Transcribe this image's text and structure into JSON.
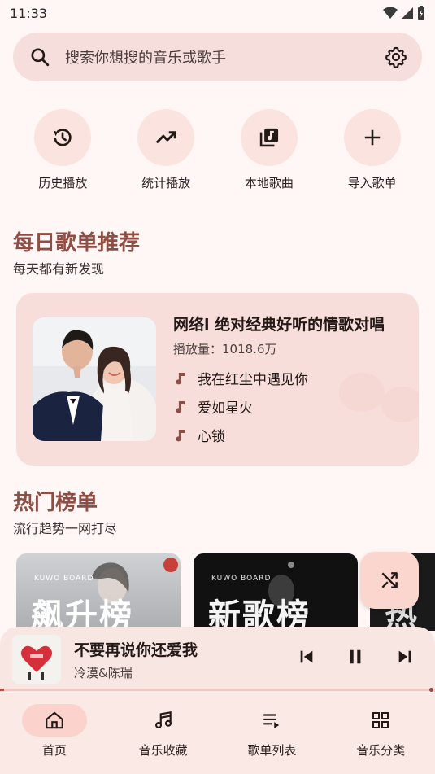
{
  "status_bar": {
    "time": "11:33"
  },
  "search": {
    "placeholder": "搜索你想搜的音乐或歌手"
  },
  "quick_actions": [
    {
      "label": "历史播放",
      "icon": "history-icon"
    },
    {
      "label": "统计播放",
      "icon": "trending-up-icon"
    },
    {
      "label": "本地歌曲",
      "icon": "music-library-icon"
    },
    {
      "label": "导入歌单",
      "icon": "plus-icon"
    }
  ],
  "daily": {
    "title": "每日歌单推荐",
    "subtitle": "每天都有新发现",
    "playlist_title": "网络l 绝对经典好听的情歌对唱",
    "plays": "播放量：1018.6万",
    "songs": [
      "我在红尘中遇见你",
      "爱如星火",
      "心锁"
    ]
  },
  "hot": {
    "title": "热门榜单",
    "subtitle": "流行趋势一网打尽",
    "cards": [
      {
        "board": "KUWO BOARD",
        "name": "飙升榜"
      },
      {
        "board": "KUWO BOARD",
        "name": "新歌榜"
      },
      {
        "board": "",
        "name": "热"
      }
    ]
  },
  "now_playing": {
    "title": "不要再说你还爱我",
    "artist": "冷漠&陈瑞",
    "progress": 0.01
  },
  "nav": [
    {
      "label": "首页",
      "icon": "home-icon",
      "active": true
    },
    {
      "label": "音乐收藏",
      "icon": "music-notes-icon",
      "active": false
    },
    {
      "label": "歌单列表",
      "icon": "playlist-icon",
      "active": false
    },
    {
      "label": "音乐分类",
      "icon": "grid-icon",
      "active": false
    }
  ],
  "colors": {
    "background": "#fff7f5",
    "accent": "#8f4d44",
    "surface": "#f5dedb"
  }
}
